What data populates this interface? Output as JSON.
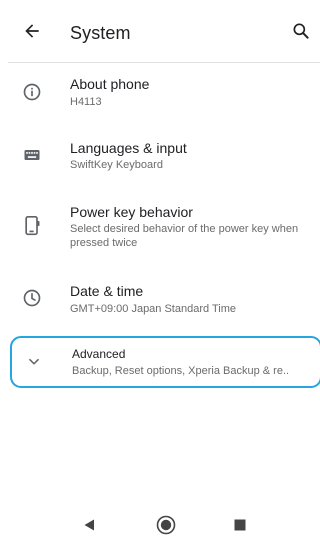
{
  "header": {
    "title": "System",
    "back_icon": "arrow-left-icon",
    "search_icon": "search-icon"
  },
  "settings": [
    {
      "icon": "info-icon",
      "title": "About phone",
      "subtitle": "H4113"
    },
    {
      "icon": "keyboard-icon",
      "title": "Languages & input",
      "subtitle": "SwiftKey Keyboard"
    },
    {
      "icon": "power-key-icon",
      "title": "Power key behavior",
      "subtitle": "Select desired behavior of the power key when pressed twice"
    },
    {
      "icon": "clock-icon",
      "title": "Date & time",
      "subtitle": "GMT+09:00 Japan Standard Time"
    }
  ],
  "advanced": {
    "icon": "chevron-down-icon",
    "title": "Advanced",
    "subtitle": "Backup, Reset options, Xperia Backup & re.."
  },
  "navigation_bar": [
    "back-triangle-icon",
    "home-circle-icon",
    "recents-square-icon"
  ],
  "colors": {
    "highlight_border": "#27a5e0",
    "text_primary": "#202124",
    "text_secondary": "#6b6b6b",
    "icon": "#5f6368"
  }
}
